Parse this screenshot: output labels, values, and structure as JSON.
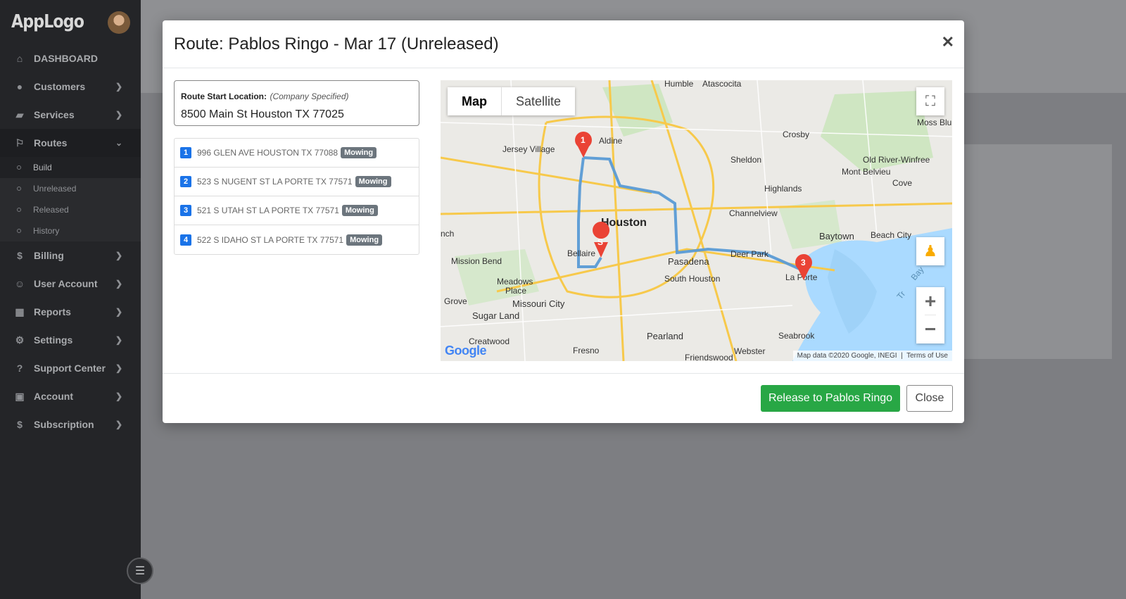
{
  "app": {
    "logo": "AppLogo"
  },
  "sidebar": {
    "items": [
      {
        "label": "DASHBOARD",
        "icon": "home-icon"
      },
      {
        "label": "Customers",
        "icon": "user-icon"
      },
      {
        "label": "Services",
        "icon": "mower-icon"
      },
      {
        "label": "Routes",
        "icon": "flag-icon"
      },
      {
        "label": "Billing",
        "icon": "dollar-circle-icon"
      },
      {
        "label": "User Account",
        "icon": "user-circle-icon"
      },
      {
        "label": "Reports",
        "icon": "table-icon"
      },
      {
        "label": "Settings",
        "icon": "gear-icon"
      },
      {
        "label": "Support Center",
        "icon": "question-icon"
      },
      {
        "label": "Account",
        "icon": "id-card-icon"
      },
      {
        "label": "Subscription",
        "icon": "dollar-icon"
      }
    ],
    "routes_sub": [
      "Build",
      "Unreleased",
      "Released",
      "History"
    ]
  },
  "modal": {
    "title": "Route: Pablos Ringo - Mar 17 (Unreleased)",
    "start_label": "Route Start Location:",
    "start_spec": "(Company Specified)",
    "start_address": "8500 Main St Houston TX 77025",
    "stops": [
      {
        "num": "1",
        "address": "996 GLEN AVE HOUSTON TX 77088",
        "tag": "Mowing"
      },
      {
        "num": "2",
        "address": "523 S NUGENT ST LA PORTE TX 77571",
        "tag": "Mowing"
      },
      {
        "num": "3",
        "address": "521 S UTAH ST LA PORTE TX 77571",
        "tag": "Mowing"
      },
      {
        "num": "4",
        "address": "522 S IDAHO ST LA PORTE TX 77571",
        "tag": "Mowing"
      }
    ],
    "map": {
      "type_map": "Map",
      "type_satellite": "Satellite",
      "attribution": "Map data ©2020 Google, INEGI",
      "terms": "Terms of Use",
      "google": "Google",
      "pins": [
        "S",
        "1",
        "3"
      ],
      "labels": [
        "Humble",
        "Atascocita",
        "Aldine",
        "Crosby",
        "Jersey Village",
        "Moss Blu",
        "Sheldon",
        "Old River-Winfree",
        "Mont Belvieu",
        "Highlands",
        "Cove",
        "Channelview",
        "Houston",
        "Baytown",
        "Beach City",
        "Bellaire",
        "Deer Park",
        "Mission Bend",
        "Pasadena",
        "La Porte",
        "South Houston",
        "Meadows Place",
        "Missouri City",
        "Sugar Land",
        "Pearland",
        "Seabrook",
        "Fresno",
        "Webster",
        "Friendswood",
        "Grove",
        "nch",
        "Creatwood",
        "Bay",
        "Tr"
      ]
    },
    "release_label": "Release to Pablos Ringo",
    "close_label": "Close"
  }
}
